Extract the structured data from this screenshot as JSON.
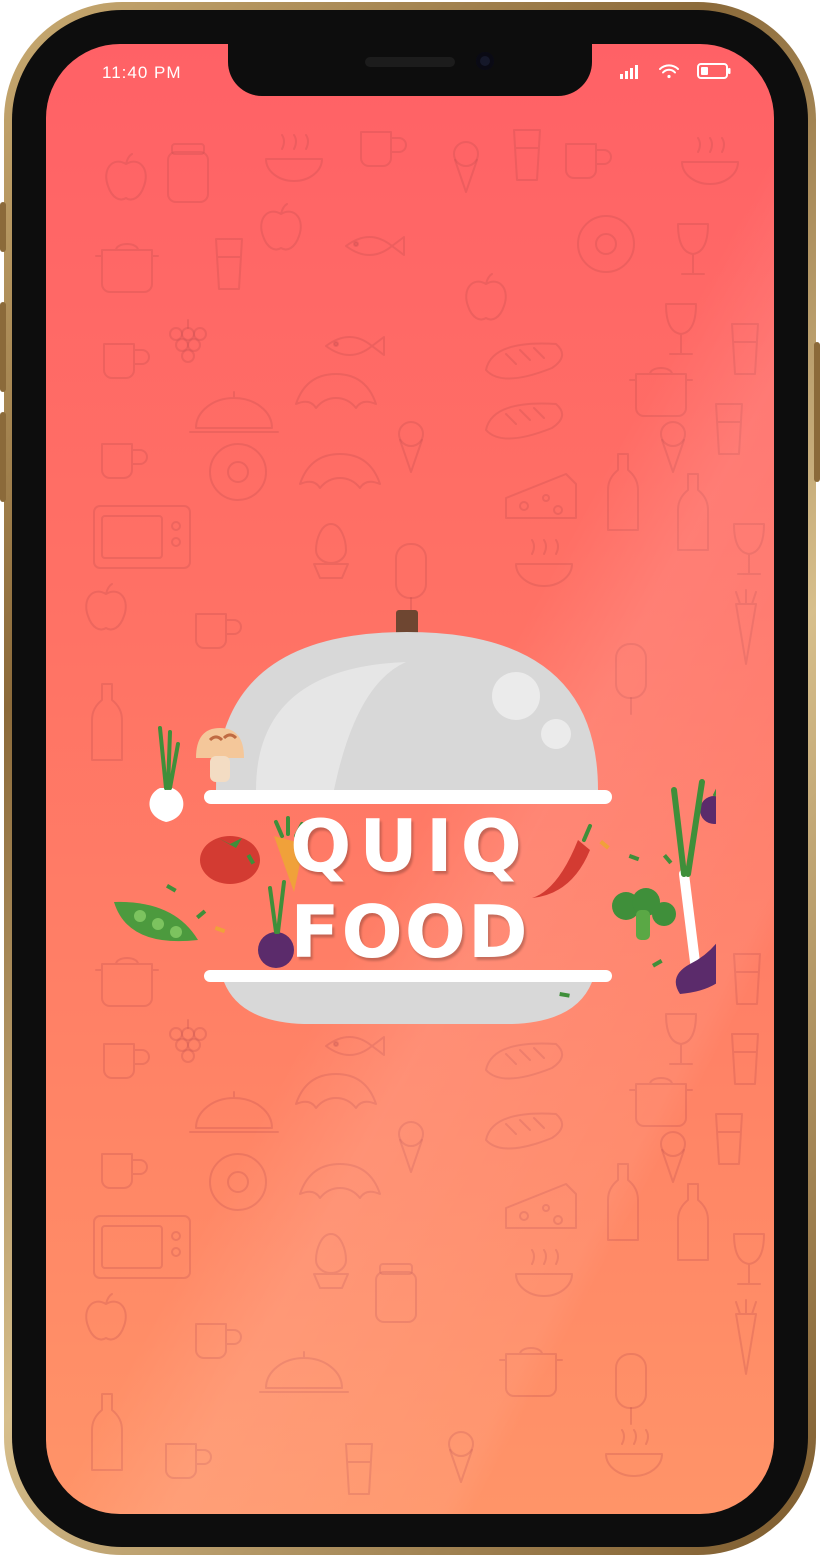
{
  "status_bar": {
    "time": "11:40 PM",
    "icons": [
      "signal-icon",
      "wifi-icon",
      "battery-icon"
    ]
  },
  "splash": {
    "logo_line1": "QUIQ",
    "logo_line2": "FOOD",
    "logo_icon": "serving-cloche-icon"
  },
  "colors": {
    "gradient_top": "#ff6166",
    "gradient_bottom": "#ff9468",
    "cloche": "#d9d9d9",
    "text": "#ffffff"
  }
}
